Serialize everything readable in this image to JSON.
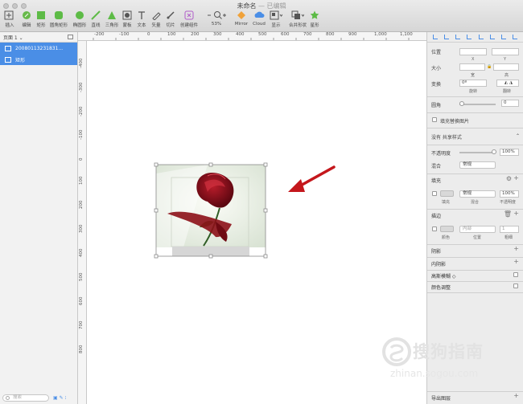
{
  "window": {
    "title": "未命名",
    "edited_label": "— 已编辑"
  },
  "toolbar": {
    "items": [
      {
        "label": "插入",
        "icon": "plus-icon"
      },
      {
        "label": "编辑",
        "icon": "edit-icon"
      },
      {
        "label": "矩形",
        "icon": "rectangle-icon"
      },
      {
        "label": "圆角矩形",
        "icon": "rounded-rectangle-icon"
      },
      {
        "label": "椭圆形",
        "icon": "oval-icon"
      },
      {
        "label": "直线",
        "icon": "line-icon"
      },
      {
        "label": "三角形",
        "icon": "triangle-icon"
      },
      {
        "label": "蒙板",
        "icon": "mask-icon"
      },
      {
        "label": "文本",
        "icon": "text-icon"
      },
      {
        "label": "矢量",
        "icon": "vector-icon"
      },
      {
        "label": "切片",
        "icon": "slice-icon"
      },
      {
        "label": "创建组件",
        "icon": "symbol-icon"
      },
      {
        "label": "53%",
        "icon": "zoom-icon"
      },
      {
        "label": "Mirror",
        "icon": "mirror-icon"
      },
      {
        "label": "Cloud",
        "icon": "cloud-icon"
      },
      {
        "label": "显示",
        "icon": "view-icon"
      },
      {
        "label": "合并形状",
        "icon": "combine-icon"
      },
      {
        "label": "星形",
        "icon": "star-icon"
      }
    ]
  },
  "sidebar": {
    "page_selector": "页面 1 ⌄",
    "layers": [
      {
        "name": "20080113231831...",
        "icon": "image-layer-icon"
      },
      {
        "name": "矩形",
        "icon": "rectangle-layer-icon"
      }
    ],
    "search_placeholder": "搜索"
  },
  "rulers": {
    "horizontal": [
      "-200",
      "-100",
      "0",
      "100",
      "200",
      "300",
      "400",
      "500",
      "600",
      "700",
      "800",
      "900",
      "1,000",
      "1,100"
    ],
    "vertical": [
      "-400",
      "-300",
      "-200",
      "-100",
      "0",
      "100",
      "200",
      "300",
      "400",
      "500",
      "600",
      "700",
      "800"
    ]
  },
  "inspector": {
    "position_label": "位置",
    "x_label": "X",
    "y_label": "Y",
    "size_label": "大小",
    "width_label": "宽",
    "height_label": "高",
    "transform_label": "变换",
    "rotation_value": "0º",
    "rotate_label": "旋转",
    "flip_label": "翻转",
    "corner_label": "圆角",
    "corner_value": "0",
    "fill_replace_label": "填充替换图片",
    "shared_style": "没有 共享样式",
    "opacity_label": "不透明度",
    "opacity_value": "100%",
    "blend_label": "混合",
    "blend_value": "常规",
    "fill_section": "填充",
    "fill_blend": "常规",
    "fill_opacity": "100%",
    "fill_sub_fill": "填充",
    "fill_sub_blend": "混合",
    "fill_sub_opacity": "不透明度",
    "border_section": "描边",
    "border_position": "内部",
    "border_width": "1",
    "border_sub_color": "颜色",
    "border_sub_position": "位置",
    "border_sub_width": "粗细",
    "shadow_section": "阴影",
    "inner_shadow_section": "内阴影",
    "gaussian_blur": "高斯模糊 ◇",
    "color_adjust": "颜色调整",
    "export_label": "导出图层"
  },
  "watermark": {
    "text": "搜狗指南",
    "url": "zhinan.sogou.com"
  },
  "colors": {
    "selection_blue": "#4a8ee6",
    "annotation_arrow": "#c4171c",
    "rose_red": "#8c0f17"
  }
}
